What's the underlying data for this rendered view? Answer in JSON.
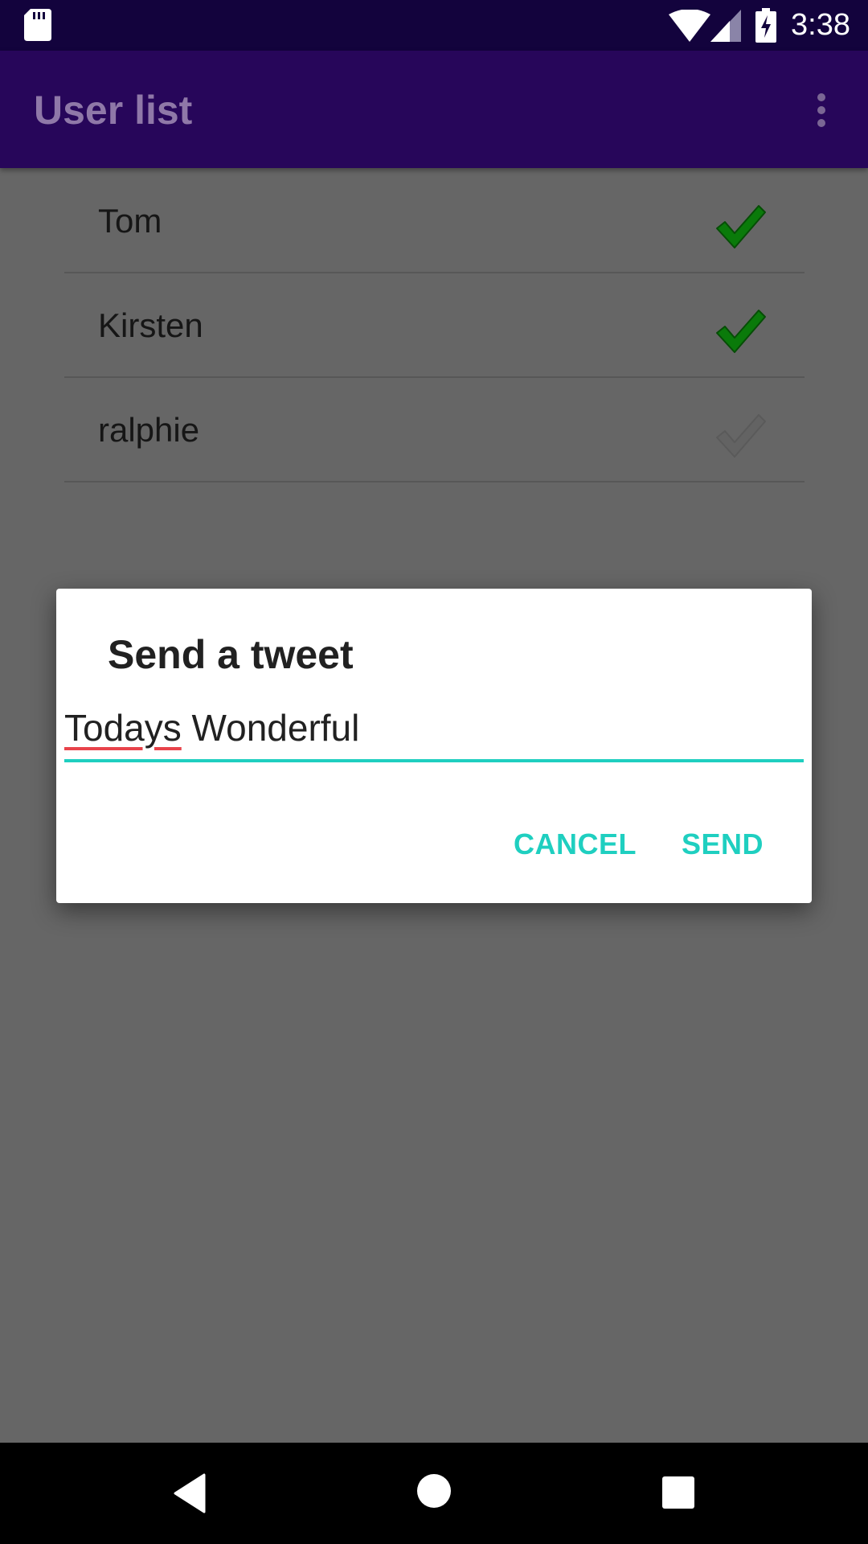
{
  "status_bar": {
    "time": "3:38",
    "icons": [
      "sd-card-icon",
      "wifi-icon",
      "signal-icon",
      "battery-charging-icon"
    ]
  },
  "app_bar": {
    "title": "User list",
    "menu_icon": "overflow-menu-icon"
  },
  "user_list": [
    {
      "name": "Tom",
      "checked": true
    },
    {
      "name": "Kirsten",
      "checked": true
    },
    {
      "name": "ralphie",
      "checked": false
    }
  ],
  "dialog": {
    "title": "Send a tweet",
    "input_value_misspelled_word": "Todays",
    "input_value_rest": " Wonderful",
    "cancel_label": "CANCEL",
    "send_label": "SEND"
  },
  "nav_bar": {
    "icons": [
      "back-icon",
      "home-icon",
      "recents-icon"
    ]
  },
  "colors": {
    "status_bar": "#13033d",
    "app_bar": "#27065a",
    "accent": "#1fcfc0",
    "check_on": "#0a7a0a",
    "check_off": "#5e5e5e",
    "scrim": "#666666",
    "spellcheck_underline": "#e8434b"
  }
}
